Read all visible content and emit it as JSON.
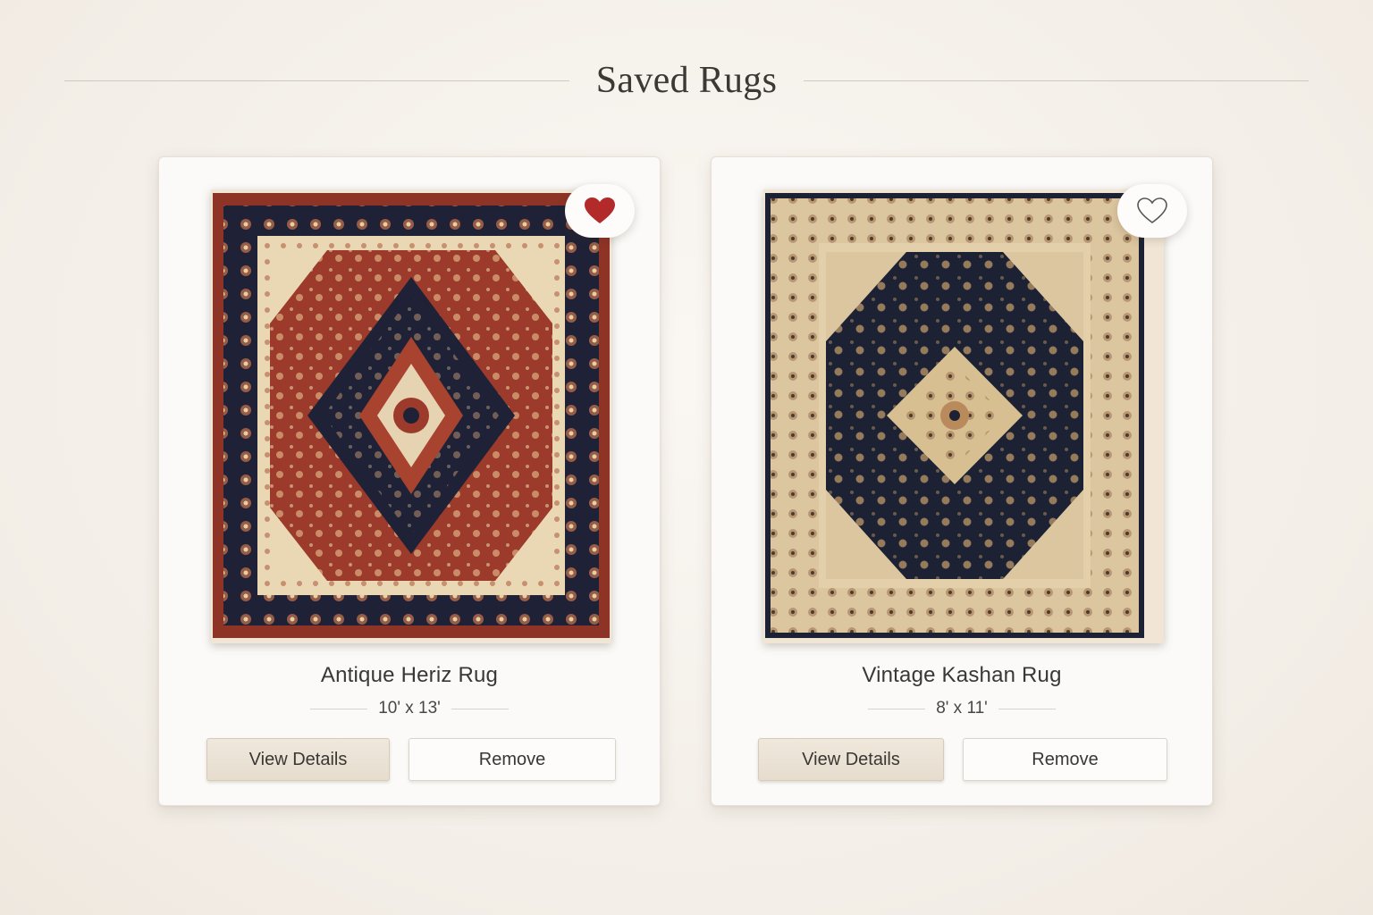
{
  "page": {
    "title": "Saved Rugs"
  },
  "colors": {
    "accent_heart": "#b22a2a",
    "button_primary": "#e9e1d3",
    "background": "#f5f1ec"
  },
  "rugs": [
    {
      "name": "Antique Heriz Rug",
      "size": "10' x 13'",
      "favorited": true,
      "favorite_icon": "heart-filled-icon",
      "view_details_label": "View Details",
      "remove_label": "Remove",
      "palette": {
        "field": "#9c3b2b",
        "border": "#1f2236",
        "ivory": "#e6d3b2",
        "accent": "#c98a5a"
      }
    },
    {
      "name": "Vintage Kashan Rug",
      "size": "8' x 11'",
      "favorited": false,
      "favorite_icon": "heart-outline-icon",
      "view_details_label": "View Details",
      "remove_label": "Remove",
      "palette": {
        "field": "#1c2233",
        "border": "#d9c29a",
        "ivory": "#ecdcbc",
        "accent": "#b88a5c"
      }
    }
  ]
}
